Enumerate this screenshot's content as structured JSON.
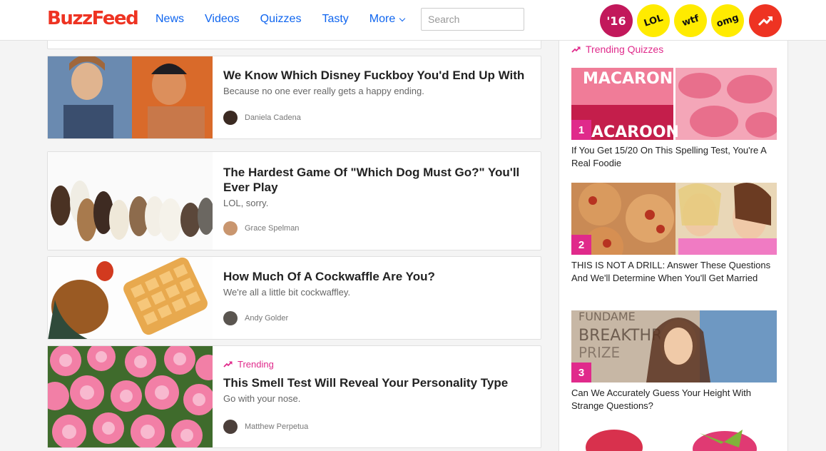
{
  "header": {
    "logo": "BuzzFeed",
    "nav": [
      "News",
      "Videos",
      "Quizzes",
      "Tasty",
      "More"
    ],
    "search_placeholder": "Search",
    "badges": [
      "'16",
      "LOL",
      "wtf",
      "omg"
    ]
  },
  "feed": [
    {
      "title": "We Know Which Disney Fuckboy You'd End Up With",
      "description": "Because no one ever really gets a happy ending.",
      "author": "Daniela Cadena"
    },
    {
      "title": "The Hardest Game Of \"Which Dog Must Go?\" You'll Ever Play",
      "description": "LOL, sorry.",
      "author": "Grace Spelman"
    },
    {
      "title": "How Much Of A Cockwaffle Are You?",
      "description": "We're all a little bit cockwaffley.",
      "author": "Andy Golder"
    },
    {
      "tag": "Trending",
      "title": "This Smell Test Will Reveal Your Personality Type",
      "description": "Go with your nose.",
      "author": "Matthew Perpetua"
    }
  ],
  "sidebar": {
    "heading": "Trending Quizzes",
    "items": [
      {
        "num": "1",
        "title": "If You Get 15/20 On This Spelling Test, You're A Real Foodie",
        "img_text_top": "MACARON",
        "img_text_bottom": "ACAROON"
      },
      {
        "num": "2",
        "title": "THIS IS NOT A DRILL: Answer These Questions And We'll Determine When You'll Get Married"
      },
      {
        "num": "3",
        "title": "Can We Accurately Guess Your Height With Strange Questions?",
        "img_text_top": "FUNDAME",
        "img_text_mid": "BREAKTHR",
        "img_text_bottom": "PRIZE"
      }
    ]
  },
  "colors": {
    "brand_red": "#ee3322",
    "nav_blue": "#0f65ef",
    "trending_pink": "#e02a8b",
    "badge_yellow": "#ffeb00"
  }
}
